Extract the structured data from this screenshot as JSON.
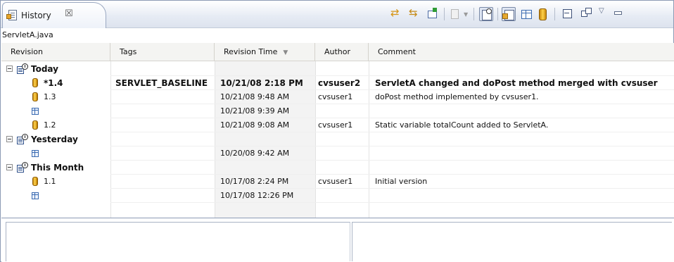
{
  "view": {
    "tab_title": "History",
    "close_glyph": "☒",
    "file_name": "ServletA.java"
  },
  "toolbar": {
    "icons": [
      "refresh-icon",
      "compare-mode-icon",
      "link-with-editor-icon",
      "pin-icon",
      "dropdown-icon",
      "show-history-icon",
      "local-revisions-icon",
      "table-mode-icon",
      "remote-revisions-icon",
      "collapse-all-icon",
      "layout-icon",
      "view-menu-icon",
      "minimize-icon"
    ],
    "menu_glyph": "▽",
    "minimize_glyph": "▭"
  },
  "table": {
    "columns": [
      "Revision",
      "Tags",
      "Revision Time",
      "Author",
      "Comment"
    ],
    "sort_indicator": "▼",
    "groups": [
      {
        "label": "Today",
        "rows": [
          {
            "icon": "revision-drum-icon",
            "revision": "*1.4",
            "tags": "SERVLET_BASELINE",
            "time": "10/21/08 2:18 PM",
            "author": "cvsuser2",
            "comment": "ServletA changed and doPost method merged with cvsuser",
            "bold": true
          },
          {
            "icon": "revision-drum-icon",
            "revision": "1.3",
            "tags": "",
            "time": "10/21/08 9:48 AM",
            "author": "cvsuser1",
            "comment": "doPost method implemented by cvsuser1.",
            "bold": false
          },
          {
            "icon": "local-revision-icon",
            "revision": "",
            "tags": "",
            "time": "10/21/08 9:39 AM",
            "author": "",
            "comment": "",
            "bold": false
          },
          {
            "icon": "revision-drum-icon",
            "revision": "1.2",
            "tags": "",
            "time": "10/21/08 9:08 AM",
            "author": "cvsuser1",
            "comment": "Static variable totalCount added to ServletA.",
            "bold": false
          }
        ]
      },
      {
        "label": "Yesterday",
        "rows": [
          {
            "icon": "local-revision-icon",
            "revision": "",
            "tags": "",
            "time": "10/20/08 9:42 AM",
            "author": "",
            "comment": "",
            "bold": false
          }
        ]
      },
      {
        "label": "This Month",
        "rows": [
          {
            "icon": "revision-drum-icon",
            "revision": "1.1",
            "tags": "",
            "time": "10/17/08 2:24 PM",
            "author": "cvsuser1",
            "comment": "Initial version",
            "bold": false
          },
          {
            "icon": "local-revision-icon",
            "revision": "",
            "tags": "",
            "time": "10/17/08 12:26 PM",
            "author": "",
            "comment": "",
            "bold": false
          }
        ]
      }
    ]
  }
}
